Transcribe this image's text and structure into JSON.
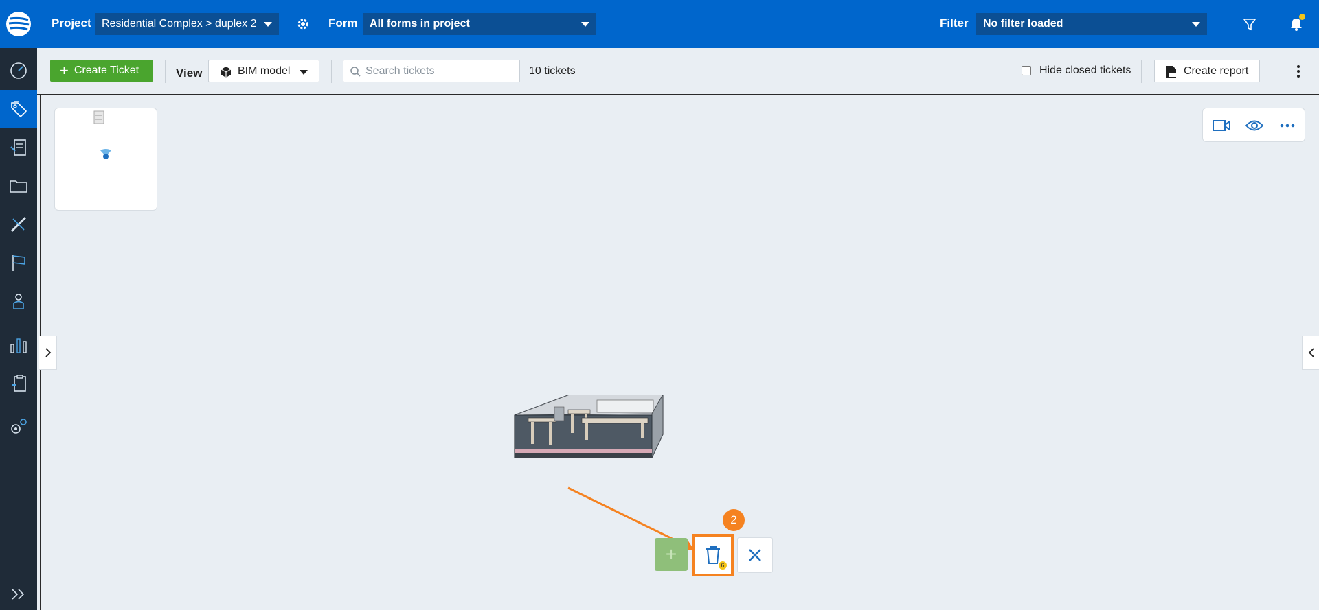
{
  "header": {
    "project_label": "Project",
    "project_value": "Residential Complex > duplex 2",
    "form_label": "Form",
    "form_value": "All forms in project",
    "filter_label": "Filter",
    "filter_value": "No filter loaded",
    "icons": [
      "settings-gear-icon",
      "filter-funnel-icon",
      "notification-bell-icon"
    ],
    "accent": "#0066cc",
    "notification_dot_color": "#f5c518"
  },
  "sidebar": {
    "background": "#1f2b38",
    "active_color": "#0066cc",
    "items": [
      {
        "icon": "dashboard-gauge-icon",
        "active": false
      },
      {
        "icon": "tickets-tags-icon",
        "active": true
      },
      {
        "icon": "forms-documents-icon",
        "active": false
      },
      {
        "icon": "folder-icon",
        "active": false
      },
      {
        "icon": "measure-tools-icon",
        "active": false
      },
      {
        "icon": "flag-map-icon",
        "active": false
      },
      {
        "icon": "user-contact-icon",
        "active": false
      },
      {
        "icon": "bar-chart-icon",
        "active": false
      },
      {
        "icon": "clipboard-icon",
        "active": false
      },
      {
        "icon": "settings-gears-icon",
        "active": false
      },
      {
        "icon": "expand-sidebar-icon",
        "active": false
      }
    ]
  },
  "toolbar": {
    "create_ticket_label": "Create Ticket",
    "view_label": "View",
    "view_value": "BIM model",
    "search_placeholder": "Search tickets",
    "tickets_count": "10 tickets",
    "hide_closed_label": "Hide closed tickets",
    "hide_closed_checked": false,
    "create_report_label": "Create report",
    "create_button_color": "#4aa52e"
  },
  "viewport": {
    "tools": [
      "camera-video-icon",
      "eye-visibility-icon",
      "more-dots-icon"
    ],
    "actions": {
      "add_icon": "plus-icon",
      "delete_icon": "trash-icon",
      "delete_count": "6",
      "close_icon": "close-x-icon"
    },
    "annotation": {
      "step_number": "2",
      "highlight_color": "#f58220"
    }
  }
}
